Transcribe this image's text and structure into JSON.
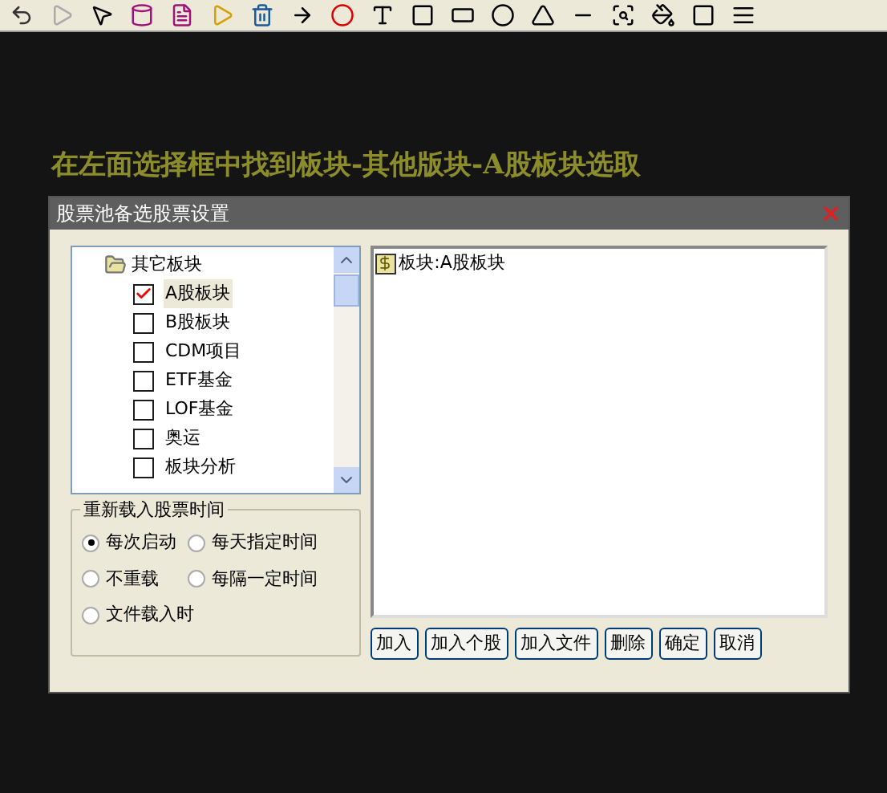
{
  "instruction": "在左面选择框中找到板块-其他版块-A股板块选取",
  "dialog": {
    "title": "股票池备选股票设置",
    "tree": {
      "label": "其它板块",
      "expanded": true,
      "children": [
        {
          "label": "A股板块",
          "checked": true,
          "selected": true
        },
        {
          "label": "B股板块",
          "checked": false,
          "selected": false
        },
        {
          "label": "CDM项目",
          "checked": false,
          "selected": false
        },
        {
          "label": "ETF基金",
          "checked": false,
          "selected": false
        },
        {
          "label": "LOF基金",
          "checked": false,
          "selected": false
        },
        {
          "label": "奥运",
          "checked": false,
          "selected": false
        },
        {
          "label": "板块分析",
          "checked": false,
          "selected": false
        }
      ]
    },
    "selected_list": [
      "板块:A股板块"
    ],
    "reload_group": {
      "title": "重新载入股票时间",
      "options": [
        {
          "label": "每次启动",
          "selected": true
        },
        {
          "label": "每天指定时间",
          "selected": false
        },
        {
          "label": "不重载",
          "selected": false
        },
        {
          "label": "每隔一定时间",
          "selected": false
        },
        {
          "label": "文件载入时",
          "selected": false
        }
      ]
    },
    "buttons": [
      "加入",
      "加入个股",
      "加入文件",
      "删除",
      "确定",
      "取消"
    ]
  }
}
